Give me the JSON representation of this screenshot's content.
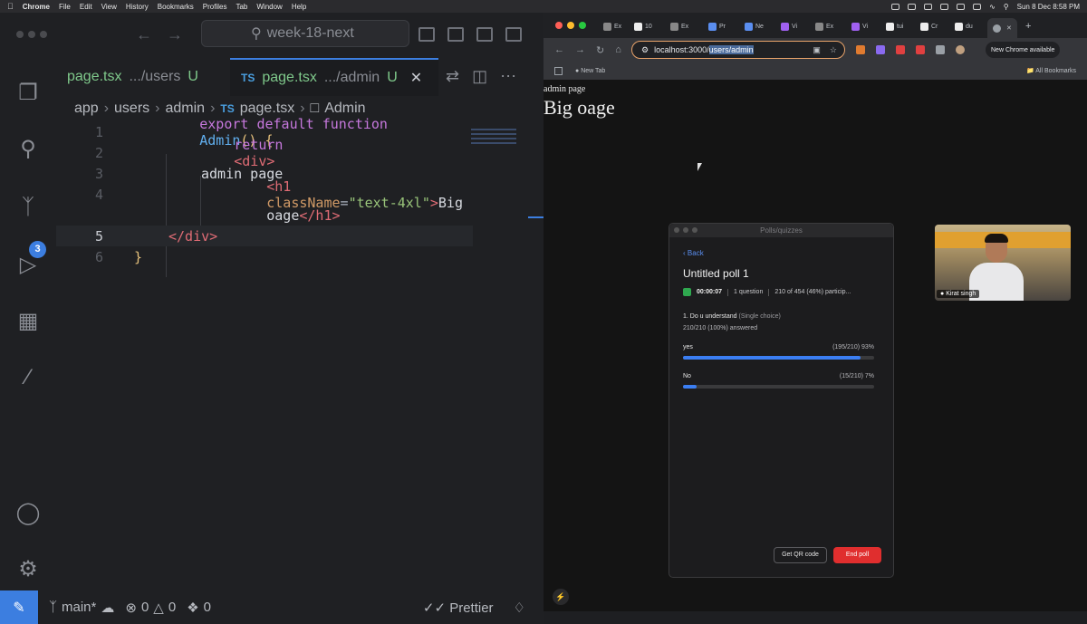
{
  "menubar": {
    "app": "Chrome",
    "items": [
      "File",
      "Edit",
      "View",
      "History",
      "Bookmarks",
      "Profiles",
      "Tab",
      "Window",
      "Help"
    ],
    "clock": "Sun 8 Dec  8:58 PM"
  },
  "vscode": {
    "search_label": "week-18-next",
    "tabs": [
      {
        "file": "page.tsx",
        "path": ".../users",
        "status": "U"
      },
      {
        "file": "page.tsx",
        "path": ".../admin",
        "status": "U",
        "lang": "TS"
      }
    ],
    "breadcrumb": {
      "parts": [
        "app",
        "users",
        "admin"
      ],
      "lang": "TS",
      "file": "page.tsx",
      "symbol": "Admin"
    },
    "line_numbers": [
      "1",
      "2",
      "3",
      "4",
      "",
      "5",
      "6"
    ],
    "code": {
      "l1_kw": "export default function",
      "l1_fn": "Admin",
      "l1_rest": "() {",
      "l2_kw": "return",
      "l2_tag": "<div>",
      "l3_text": "admin page",
      "l4_tag_open": "<h1",
      "l4_attr": "className",
      "l4_eq": "=",
      "l4_str": "\"text-4xl\"",
      "l4_gt": ">",
      "l4_text": "Big",
      "l4b_text": "oage",
      "l4b_tag": "</h1>",
      "l5_tag": "</div>",
      "l6_brace": "}"
    },
    "scm_badge": "3",
    "status": {
      "branch": "main*",
      "errors": "0",
      "warnings": "0",
      "ports": "0",
      "formatter": "Prettier"
    }
  },
  "chrome": {
    "url_host": "localhost:3000/",
    "url_selected": "users/admin",
    "bookmark_newtab": "New Tab",
    "bookmark_all": "All Bookmarks",
    "new_chrome_label": "New Chrome available",
    "tabs": [
      "Ex",
      "10",
      "Ex",
      "Pr",
      "Ne",
      "Vi",
      "Ex",
      "Vi",
      "tui",
      "Cr",
      "du",
      ""
    ]
  },
  "page": {
    "admin_text": "admin page",
    "heading": "Big oage"
  },
  "poll": {
    "window_title": "Polls/quizzes",
    "back_label": "Back",
    "title": "Untitled poll 1",
    "timer": "00:00:07",
    "question_count": "1 question",
    "participation": "210 of 454 (46%) particip...",
    "question": "1. Do u understand",
    "question_type": "(Single choice)",
    "answered": "210/210 (100%) answered",
    "options": [
      {
        "label": "yes",
        "stat": "(195/210) 93%",
        "fraction": 0.93
      },
      {
        "label": "No",
        "stat": "(15/210) 7%",
        "fraction": 0.07
      }
    ],
    "qr_button": "Get QR code",
    "end_button": "End poll"
  },
  "webcam": {
    "name": "Kirat singh"
  }
}
